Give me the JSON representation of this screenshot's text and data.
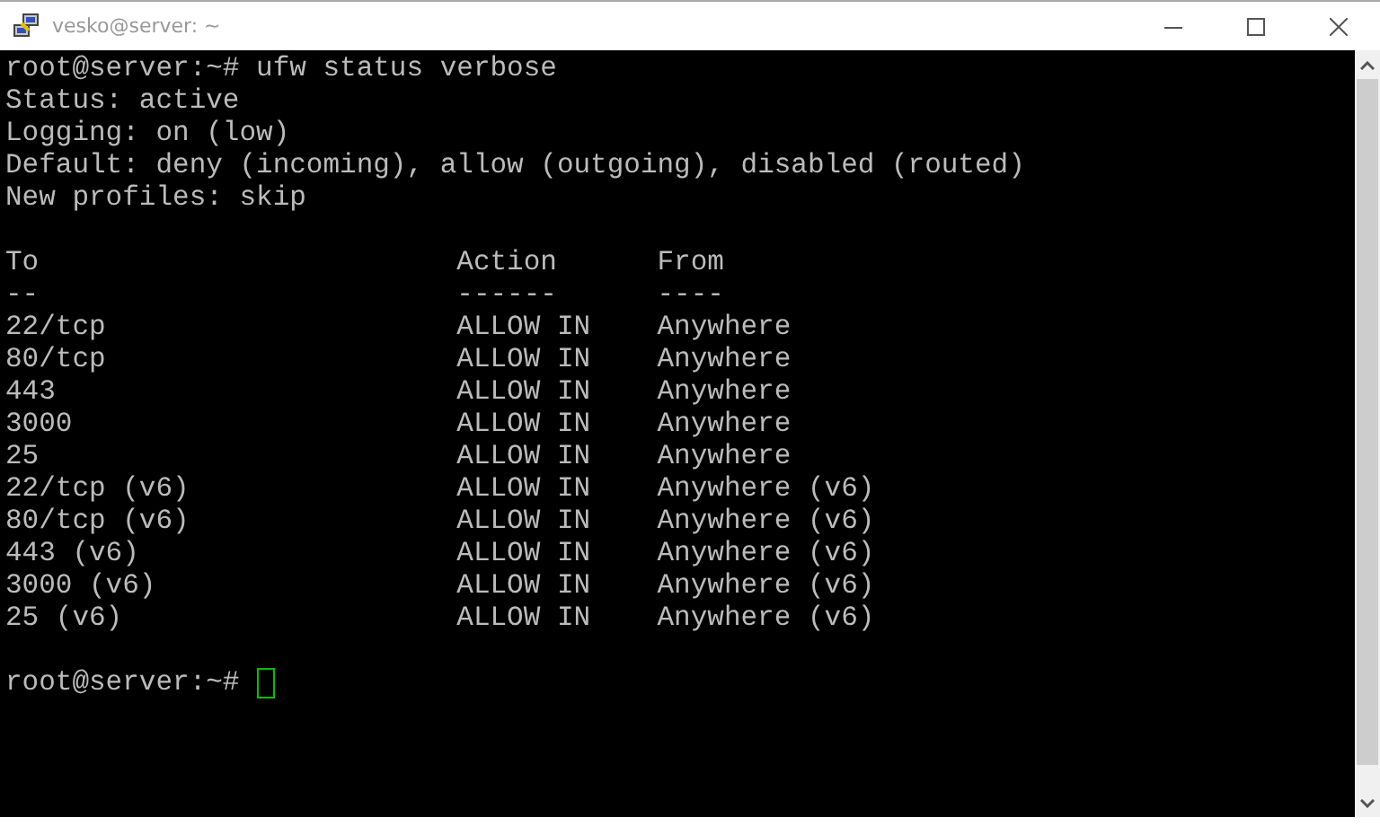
{
  "window": {
    "title": "vesko@server: ~"
  },
  "terminal": {
    "command_line": "root@server:~# ufw status verbose",
    "info_lines": [
      "Status: active",
      "Logging: on (low)",
      "Default: deny (incoming), allow (outgoing), disabled (routed)",
      "New profiles: skip"
    ],
    "table": {
      "columns": [
        "To",
        "Action",
        "From"
      ],
      "dividers": [
        "--",
        "------",
        "----"
      ],
      "rows": [
        [
          "22/tcp",
          "ALLOW IN",
          "Anywhere"
        ],
        [
          "80/tcp",
          "ALLOW IN",
          "Anywhere"
        ],
        [
          "443",
          "ALLOW IN",
          "Anywhere"
        ],
        [
          "3000",
          "ALLOW IN",
          "Anywhere"
        ],
        [
          "25",
          "ALLOW IN",
          "Anywhere"
        ],
        [
          "22/tcp (v6)",
          "ALLOW IN",
          "Anywhere (v6)"
        ],
        [
          "80/tcp (v6)",
          "ALLOW IN",
          "Anywhere (v6)"
        ],
        [
          "443 (v6)",
          "ALLOW IN",
          "Anywhere (v6)"
        ],
        [
          "3000 (v6)",
          "ALLOW IN",
          "Anywhere (v6)"
        ],
        [
          "25 (v6)",
          "ALLOW IN",
          "Anywhere (v6)"
        ]
      ]
    },
    "prompt": "root@server:~#"
  }
}
